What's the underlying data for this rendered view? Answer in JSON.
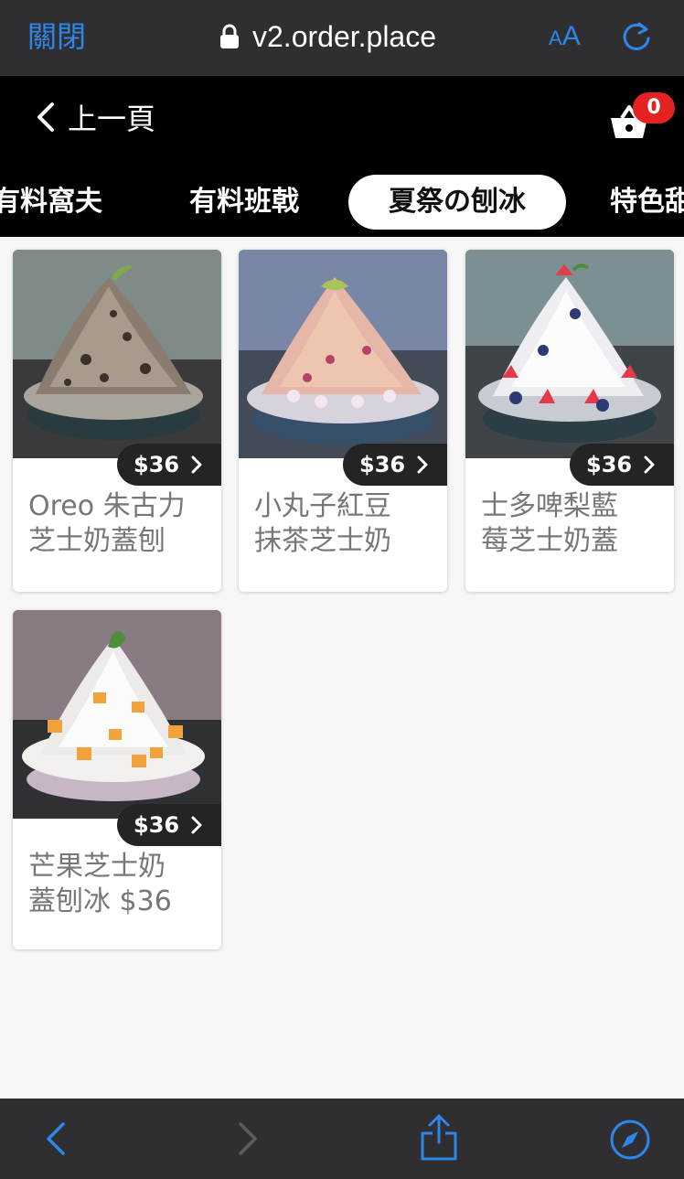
{
  "browser": {
    "close_label": "關閉",
    "url": "v2.order.place",
    "text_size_small": "A",
    "text_size_big": "A",
    "accent_color": "#2f86ea"
  },
  "header": {
    "back_label": "上一頁",
    "cart_count": "0"
  },
  "tabs": [
    {
      "label": "有料窩夫",
      "active": false
    },
    {
      "label": "有料班戟",
      "active": false
    },
    {
      "label": "夏祭の刨冰",
      "active": true
    },
    {
      "label": "特色甜",
      "active": false
    }
  ],
  "products": [
    {
      "name_line1": "Oreo 朱古力",
      "name_line2": "芝士奶蓋刨",
      "price": "$36",
      "topping": "oreo"
    },
    {
      "name_line1": "小丸子紅豆",
      "name_line2": "抹茶芝士奶",
      "price": "$36",
      "topping": "redbean"
    },
    {
      "name_line1": "士多啤梨藍",
      "name_line2": "莓芝士奶蓋",
      "price": "$36",
      "topping": "berry"
    },
    {
      "name_line1": "芒果芝士奶",
      "name_line2": "蓋刨冰 $36",
      "price": "$36",
      "topping": "mango"
    }
  ],
  "icons": [
    "lock-icon",
    "reload-icon",
    "back-chevron-icon",
    "cart-icon",
    "chevron-right-icon",
    "nav-back-icon",
    "nav-forward-icon",
    "share-icon",
    "compass-icon"
  ]
}
